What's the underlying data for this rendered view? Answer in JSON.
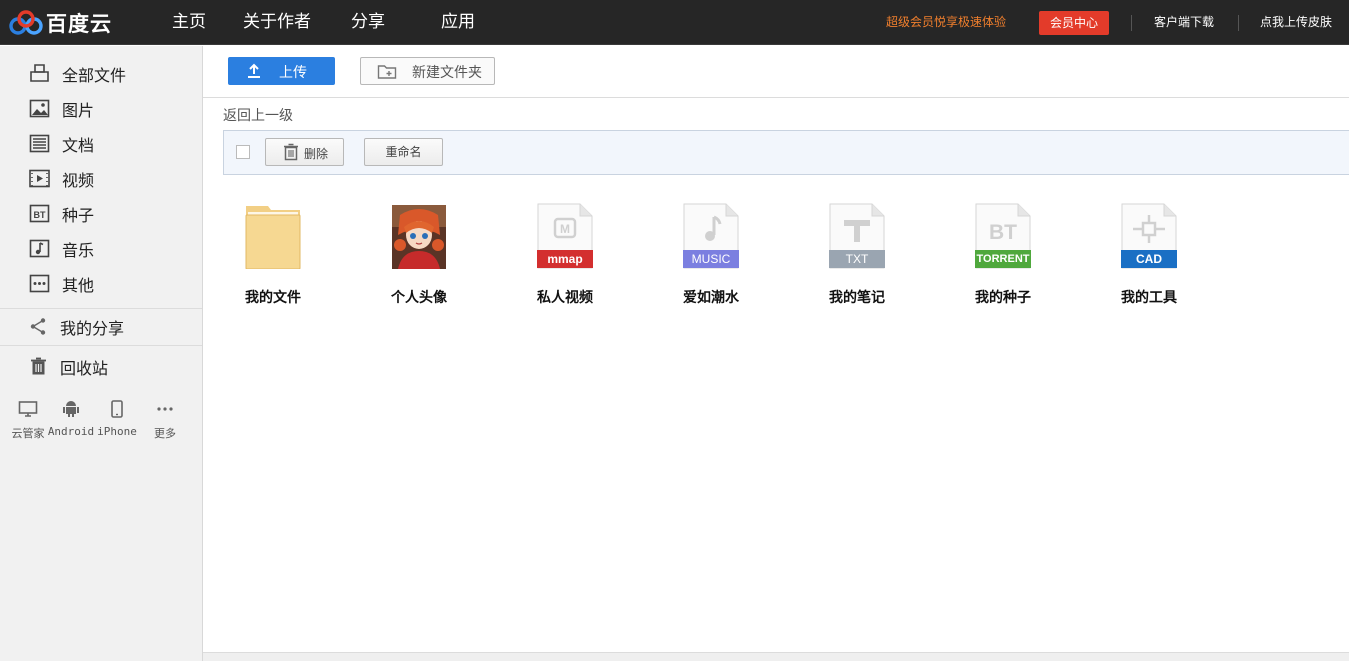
{
  "header": {
    "logo_text": "百度云",
    "nav": [
      "主页",
      "关于作者",
      "分享",
      "应用"
    ],
    "promo": "超级会员悦享极速体验",
    "vip_button": "会员中心",
    "client_download": "客户端下载",
    "change_skin": "点我上传皮肤",
    "colors": {
      "bar": "#262626",
      "promo": "#f07f2d",
      "vip": "#e33b2a"
    }
  },
  "sidebar": {
    "items": [
      {
        "label": "全部文件",
        "icon": "all-files-icon"
      },
      {
        "label": "图片",
        "icon": "image-icon"
      },
      {
        "label": "文档",
        "icon": "document-icon"
      },
      {
        "label": "视频",
        "icon": "video-icon"
      },
      {
        "label": "种子",
        "icon": "bt-icon"
      },
      {
        "label": "音乐",
        "icon": "music-icon"
      },
      {
        "label": "其他",
        "icon": "more-dots-icon"
      }
    ],
    "share": {
      "label": "我的分享",
      "icon": "share-icon"
    },
    "trash": {
      "label": "回收站",
      "icon": "trash-icon"
    },
    "devices": [
      {
        "label": "云管家",
        "icon": "monitor-icon"
      },
      {
        "label": "Android",
        "icon": "android-icon"
      },
      {
        "label": "iPhone",
        "icon": "phone-icon"
      },
      {
        "label": "更多",
        "icon": "more-icon"
      }
    ]
  },
  "toolbar": {
    "upload": "上传",
    "new_folder": "新建文件夹"
  },
  "nav_back": "返回上一级",
  "actions": {
    "delete": "删除",
    "rename": "重命名"
  },
  "files": [
    {
      "name": "我的文件",
      "type": "folder"
    },
    {
      "name": "个人头像",
      "type": "image"
    },
    {
      "name": "私人视频",
      "type": "mmap",
      "badge": "mmap",
      "badge_color": "#d32f2f"
    },
    {
      "name": "爱如潮水",
      "type": "music",
      "badge": "MUSIC",
      "badge_color": "#7b7fe0"
    },
    {
      "name": "我的笔记",
      "type": "txt",
      "badge": "TXT",
      "badge_color": "#9aa5b1"
    },
    {
      "name": "我的种子",
      "type": "torrent",
      "badge": "TORRENT",
      "badge_color": "#4fa83d"
    },
    {
      "name": "我的工具",
      "type": "cad",
      "badge": "CAD",
      "badge_color": "#1a6fc4"
    }
  ],
  "accent": "#2b7fe0"
}
